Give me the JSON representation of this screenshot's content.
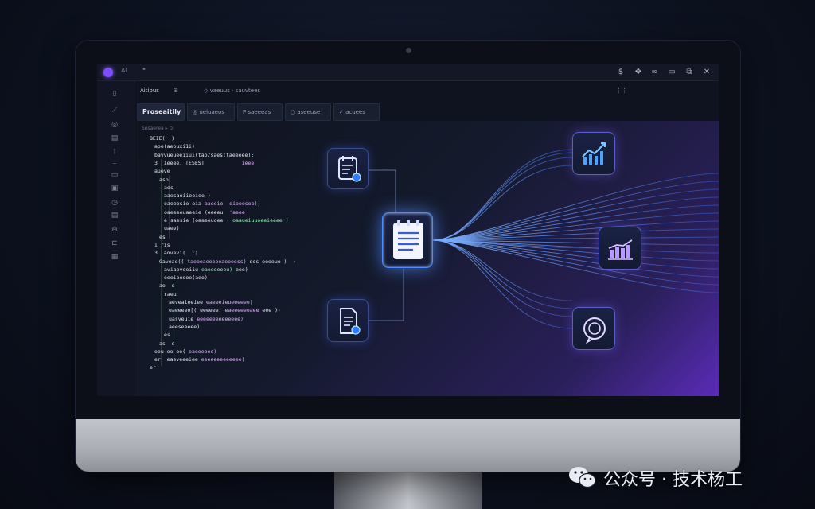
{
  "window": {
    "app_name": "AI",
    "title_small": "•",
    "titlebar_icons": [
      "dollar-icon",
      "cursor-icon",
      "infinity-icon",
      "window-icon",
      "restore-icon",
      "close-icon"
    ],
    "titlebar_glyphs": [
      "$",
      "✥",
      "∞",
      "▭",
      "⧉",
      "✕"
    ]
  },
  "toolbar": {
    "items": [
      {
        "label": "Aitibus"
      },
      {
        "label": "⊞"
      },
      {
        "label": "◇ vaeuus · sauvtees"
      },
      {
        "label": "⋮⋮"
      }
    ]
  },
  "tabs": [
    {
      "label": "Proseaitily",
      "active": true
    },
    {
      "label": "◎ ueiuaeos"
    },
    {
      "label": "P saeeeas"
    },
    {
      "label": "○ aseeuse"
    },
    {
      "label": "✓ acuees"
    }
  ],
  "breadcrumb": "Sesaerea ▸ ⊙",
  "code_lines": [
    {
      "indent": 0,
      "parts": [
        [
          "k",
          "BEIE( :)"
        ]
      ]
    },
    {
      "indent": 1,
      "parts": [
        [
          "k",
          "aoe(aeouxi1i)"
        ]
      ]
    },
    {
      "indent": 1,
      "parts": [
        [
          "k",
          "bavvueueeiiui(tao/saes(taeeeee);"
        ]
      ]
    },
    {
      "indent": 1,
      "parts": [
        [
          "k",
          "3  ieeee, [ESES] "
        ],
        [
          "s",
          "           ieee"
        ]
      ]
    },
    {
      "indent": 1,
      "parts": [
        [
          "k",
          "aueve"
        ]
      ]
    },
    {
      "indent": 2,
      "parts": [
        [
          "k",
          "aso"
        ]
      ]
    },
    {
      "indent": 3,
      "parts": [
        [
          "k",
          "aes"
        ]
      ]
    },
    {
      "indent": 3,
      "parts": [
        [
          "k",
          "aaesaeiieeiee )"
        ]
      ]
    },
    {
      "indent": 3,
      "parts": [
        [
          "k",
          "oaeeesie eia "
        ],
        [
          "s",
          "aaeeie  oieeesee);"
        ]
      ]
    },
    {
      "indent": 3,
      "parts": [
        [
          "k",
          "oaeeeeuaeeie (eeeeu"
        ],
        [
          "s",
          "  'aeee"
        ]
      ]
    },
    {
      "indent": 3,
      "parts": [
        [
          "k",
          "e saesie (oaaeeuoee "
        ],
        [
          "g",
          "· oaaueiuuoeeieeee )"
        ]
      ]
    },
    {
      "indent": 3,
      "parts": [
        [
          "k",
          "uaev)"
        ]
      ]
    },
    {
      "indent": 2,
      "parts": [
        [
          "k",
          "es"
        ]
      ]
    },
    {
      "indent": 1,
      "parts": [
        [
          "k",
          "i ris"
        ]
      ]
    },
    {
      "indent": 1,
      "parts": [
        [
          "k",
          "3  aovevi(  :)"
        ]
      ]
    },
    {
      "indent": 2,
      "parts": [
        [
          "k",
          "Gaveae(( "
        ],
        [
          "s",
          "taeeeaeeeoeaeeeess) "
        ],
        [
          "k",
          "oes eeeeue )  ·"
        ]
      ]
    },
    {
      "indent": 3,
      "parts": [
        [
          "k",
          "aviaeveeiiu "
        ],
        [
          "g",
          "eaeeeeeeu) "
        ],
        [
          "k",
          "eee)"
        ]
      ]
    },
    {
      "indent": 3,
      "parts": [
        [
          "k",
          "eeeieeeee(aeo)"
        ]
      ]
    },
    {
      "indent": 2,
      "parts": [
        [
          "k",
          "ao  o"
        ]
      ]
    },
    {
      "indent": 3,
      "parts": [
        [
          "k",
          "raeu"
        ]
      ]
    },
    {
      "indent": 4,
      "parts": [
        [
          "k",
          "aeveaieeiee "
        ],
        [
          "s",
          "eaeeeieueeeeee)"
        ]
      ]
    },
    {
      "indent": 4,
      "parts": [
        [
          "k",
          "eaeeeeo[( eeeeee. "
        ],
        [
          "s",
          "eaeeeeeeaee"
        ],
        [
          "k",
          " eee )·"
        ]
      ]
    },
    {
      "indent": 4,
      "parts": [
        [
          "k",
          "uasveuie "
        ],
        [
          "s",
          "eeeeeeeeeeeeee)"
        ]
      ]
    },
    {
      "indent": 4,
      "parts": [
        [
          "k",
          "aeeseeeee)"
        ]
      ]
    },
    {
      "indent": 3,
      "parts": [
        [
          "k",
          "es"
        ]
      ]
    },
    {
      "indent": 2,
      "parts": [
        [
          "k",
          "as  o"
        ]
      ]
    },
    {
      "indent": 1,
      "parts": [
        [
          "k",
          "oeu oe ee( "
        ],
        [
          "s",
          "eaeeeeee)"
        ]
      ]
    },
    {
      "indent": 1,
      "parts": [
        [
          "k",
          "er  eaeveeeiee "
        ],
        [
          "s",
          "eeeeeeeeeeeee)"
        ]
      ]
    },
    {
      "indent": 0,
      "parts": [
        [
          "k",
          "er"
        ]
      ]
    }
  ],
  "watermark": {
    "text": "公众号 · 技术杨工"
  },
  "colors": {
    "accent": "#4e8cff",
    "purple": "#7c4dff",
    "node_icon": "#dfe6ff"
  }
}
